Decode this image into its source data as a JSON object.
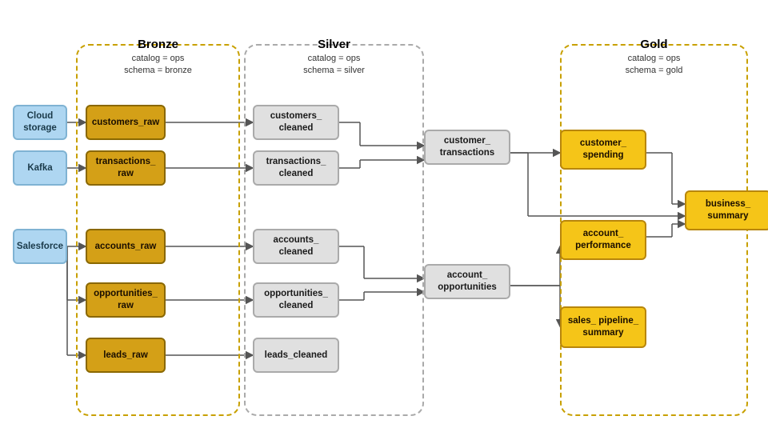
{
  "zones": {
    "bronze": {
      "title": "Bronze",
      "catalog": "catalog = ops",
      "schema": "schema = bronze"
    },
    "silver": {
      "title": "Silver",
      "catalog": "catalog = ops",
      "schema": "schema = silver"
    },
    "gold": {
      "title": "Gold",
      "catalog": "catalog = ops",
      "schema": "schema = gold"
    }
  },
  "nodes": {
    "sources": [
      {
        "id": "cloud-storage",
        "label": "Cloud storage"
      },
      {
        "id": "kafka",
        "label": "Kafka"
      },
      {
        "id": "salesforce",
        "label": "Salesforce"
      }
    ],
    "bronze": [
      {
        "id": "customers-raw",
        "label": "customers_raw"
      },
      {
        "id": "transactions-raw",
        "label": "transactions_\nraw"
      },
      {
        "id": "accounts-raw",
        "label": "accounts_raw"
      },
      {
        "id": "opportunities-raw",
        "label": "opportunities_\nraw"
      },
      {
        "id": "leads-raw",
        "label": "leads_raw"
      }
    ],
    "silver": [
      {
        "id": "customers-cleaned",
        "label": "customers_\ncleaned"
      },
      {
        "id": "transactions-cleaned",
        "label": "transactions_\ncleaned"
      },
      {
        "id": "accounts-cleaned",
        "label": "accounts_\ncleaned"
      },
      {
        "id": "opportunities-cleaned",
        "label": "opportunities_\ncleaned"
      },
      {
        "id": "leads-cleaned",
        "label": "leads_cleaned"
      },
      {
        "id": "customer-transactions",
        "label": "customer_\ntransactions"
      },
      {
        "id": "account-opportunities",
        "label": "account_\nopportunities"
      }
    ],
    "gold": [
      {
        "id": "customer-spending",
        "label": "customer_\nspending"
      },
      {
        "id": "account-performance",
        "label": "account_\nperformance"
      },
      {
        "id": "sales-pipeline-summary",
        "label": "sales_\npipeline_\nsummary"
      },
      {
        "id": "business-summary",
        "label": "business_\nsummary"
      }
    ]
  }
}
